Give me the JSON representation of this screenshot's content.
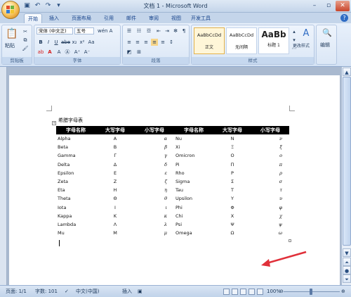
{
  "window": {
    "title": "文档 1 - Microsoft Word"
  },
  "quick_access": [
    "save-icon",
    "undo-icon",
    "redo-icon",
    "customize-icon"
  ],
  "tabs": [
    "开始",
    "插入",
    "页面布局",
    "引用",
    "邮件",
    "审阅",
    "视图",
    "开发工具"
  ],
  "active_tab": "开始",
  "ribbon": {
    "clipboard": {
      "label": "剪贴板",
      "paste": "粘贴"
    },
    "font": {
      "label": "字体",
      "font_name": "宋体 (中文正)",
      "font_size": "五号"
    },
    "paragraph": {
      "label": "段落"
    },
    "styles": {
      "label": "样式",
      "items": [
        {
          "sample": "AaBbCcDd",
          "name": "正文",
          "selected": true
        },
        {
          "sample": "AaBbCcDd",
          "name": "无间隔",
          "selected": false
        },
        {
          "sample": "AaBb",
          "name": "标题 1",
          "selected": false
        }
      ],
      "change_styles": "更改样式"
    },
    "editing": {
      "label": "编辑"
    }
  },
  "document": {
    "table_title": "希腊字母表",
    "headers": [
      "字母名称",
      "大写字母",
      "小写字母",
      "字母名称",
      "大写字母",
      "小写字母"
    ],
    "rows": [
      [
        "Alpha",
        "Α",
        "α",
        "Nu",
        "Ν",
        "ν"
      ],
      [
        "Beta",
        "Β",
        "β",
        "Xi",
        "Ξ",
        "ξ"
      ],
      [
        "Gamma",
        "Γ",
        "γ",
        "Omicron",
        "Ο",
        "ο"
      ],
      [
        "Delta",
        "Δ",
        "δ",
        "Pi",
        "Π",
        "π"
      ],
      [
        "Epsilon",
        "Ε",
        "ε",
        "Rho",
        "Ρ",
        "ρ"
      ],
      [
        "Zeta",
        "Ζ",
        "ζ",
        "Sigma",
        "Σ",
        "σ"
      ],
      [
        "Eta",
        "Η",
        "η",
        "Tau",
        "Τ",
        "τ"
      ],
      [
        "Theta",
        "Θ",
        "θ",
        "Upsilon",
        "Υ",
        "υ"
      ],
      [
        "Iota",
        "Ι",
        "ι",
        "Phi",
        "Φ",
        "φ"
      ],
      [
        "Kappa",
        "Κ",
        "κ",
        "Chi",
        "Χ",
        "χ"
      ],
      [
        "Lambda",
        "Λ",
        "λ",
        "Psi",
        "Ψ",
        "ψ"
      ],
      [
        "Mu",
        "Μ",
        "μ",
        "Omega",
        "Ω",
        "ω"
      ]
    ]
  },
  "status": {
    "page": "页面: 1/1",
    "words": "字数: 101",
    "language": "中文(中国)",
    "mode": "插入",
    "zoom": "100%"
  },
  "colors": {
    "annotation_arrow": "#e0303a",
    "table_header_bg": "#000000"
  }
}
